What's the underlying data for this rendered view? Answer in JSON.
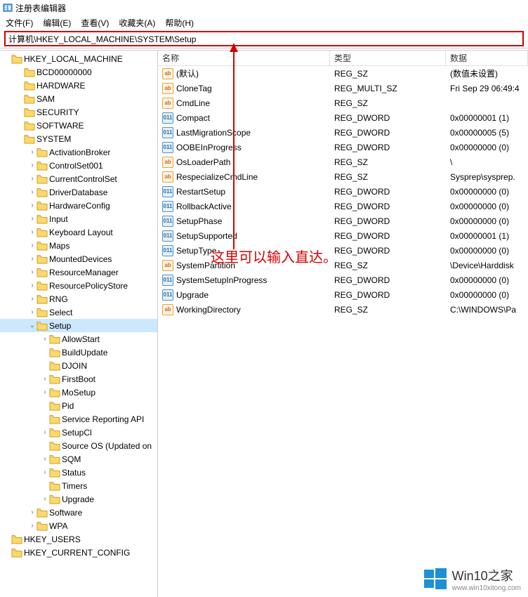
{
  "window": {
    "title": "注册表编辑器"
  },
  "menu": {
    "file": "文件(F)",
    "edit": "编辑(E)",
    "view": "查看(V)",
    "favorites": "收藏夹(A)",
    "help": "帮助(H)"
  },
  "address": {
    "path": "计算机\\HKEY_LOCAL_MACHINE\\SYSTEM\\Setup"
  },
  "tree": [
    {
      "depth": 0,
      "exp": "",
      "label": "HKEY_LOCAL_MACHINE"
    },
    {
      "depth": 1,
      "exp": "",
      "label": "BCD00000000"
    },
    {
      "depth": 1,
      "exp": "",
      "label": "HARDWARE"
    },
    {
      "depth": 1,
      "exp": "",
      "label": "SAM"
    },
    {
      "depth": 1,
      "exp": "",
      "label": "SECURITY"
    },
    {
      "depth": 1,
      "exp": "",
      "label": "SOFTWARE"
    },
    {
      "depth": 1,
      "exp": "",
      "label": "SYSTEM"
    },
    {
      "depth": 2,
      "exp": ">",
      "label": "ActivationBroker"
    },
    {
      "depth": 2,
      "exp": ">",
      "label": "ControlSet001"
    },
    {
      "depth": 2,
      "exp": ">",
      "label": "CurrentControlSet"
    },
    {
      "depth": 2,
      "exp": ">",
      "label": "DriverDatabase"
    },
    {
      "depth": 2,
      "exp": ">",
      "label": "HardwareConfig"
    },
    {
      "depth": 2,
      "exp": ">",
      "label": "Input"
    },
    {
      "depth": 2,
      "exp": ">",
      "label": "Keyboard Layout"
    },
    {
      "depth": 2,
      "exp": ">",
      "label": "Maps"
    },
    {
      "depth": 2,
      "exp": ">",
      "label": "MountedDevices"
    },
    {
      "depth": 2,
      "exp": ">",
      "label": "ResourceManager"
    },
    {
      "depth": 2,
      "exp": ">",
      "label": "ResourcePolicyStore"
    },
    {
      "depth": 2,
      "exp": ">",
      "label": "RNG"
    },
    {
      "depth": 2,
      "exp": ">",
      "label": "Select"
    },
    {
      "depth": 2,
      "exp": "v",
      "label": "Setup",
      "selected": true
    },
    {
      "depth": 3,
      "exp": ">",
      "label": "AllowStart"
    },
    {
      "depth": 3,
      "exp": "",
      "label": "BuildUpdate"
    },
    {
      "depth": 3,
      "exp": "",
      "label": "DJOIN"
    },
    {
      "depth": 3,
      "exp": ">",
      "label": "FirstBoot"
    },
    {
      "depth": 3,
      "exp": ">",
      "label": "MoSetup"
    },
    {
      "depth": 3,
      "exp": "",
      "label": "Pid"
    },
    {
      "depth": 3,
      "exp": "",
      "label": "Service Reporting API"
    },
    {
      "depth": 3,
      "exp": ">",
      "label": "SetupCl"
    },
    {
      "depth": 3,
      "exp": "",
      "label": "Source OS (Updated on"
    },
    {
      "depth": 3,
      "exp": ">",
      "label": "SQM"
    },
    {
      "depth": 3,
      "exp": ">",
      "label": "Status"
    },
    {
      "depth": 3,
      "exp": "",
      "label": "Timers"
    },
    {
      "depth": 3,
      "exp": ">",
      "label": "Upgrade"
    },
    {
      "depth": 2,
      "exp": ">",
      "label": "Software"
    },
    {
      "depth": 2,
      "exp": ">",
      "label": "WPA"
    },
    {
      "depth": 0,
      "exp": "",
      "label": "HKEY_USERS"
    },
    {
      "depth": 0,
      "exp": "",
      "label": "HKEY_CURRENT_CONFIG"
    }
  ],
  "columns": {
    "name": "名称",
    "type": "类型",
    "data": "数据"
  },
  "values": [
    {
      "icon": "sz",
      "name": "(默认)",
      "type": "REG_SZ",
      "data": "(数值未设置)"
    },
    {
      "icon": "sz",
      "name": "CloneTag",
      "type": "REG_MULTI_SZ",
      "data": "Fri Sep 29 06:49:4"
    },
    {
      "icon": "sz",
      "name": "CmdLine",
      "type": "REG_SZ",
      "data": ""
    },
    {
      "icon": "bin",
      "name": "Compact",
      "type": "REG_DWORD",
      "data": "0x00000001 (1)"
    },
    {
      "icon": "bin",
      "name": "LastMigrationScope",
      "type": "REG_DWORD",
      "data": "0x00000005 (5)"
    },
    {
      "icon": "bin",
      "name": "OOBEInProgress",
      "type": "REG_DWORD",
      "data": "0x00000000 (0)"
    },
    {
      "icon": "sz",
      "name": "OsLoaderPath",
      "type": "REG_SZ",
      "data": "\\"
    },
    {
      "icon": "sz",
      "name": "RespecializeCmdLine",
      "type": "REG_SZ",
      "data": "Sysprep\\sysprep."
    },
    {
      "icon": "bin",
      "name": "RestartSetup",
      "type": "REG_DWORD",
      "data": "0x00000000 (0)"
    },
    {
      "icon": "bin",
      "name": "RollbackActive",
      "type": "REG_DWORD",
      "data": "0x00000000 (0)"
    },
    {
      "icon": "bin",
      "name": "SetupPhase",
      "type": "REG_DWORD",
      "data": "0x00000000 (0)"
    },
    {
      "icon": "bin",
      "name": "SetupSupported",
      "type": "REG_DWORD",
      "data": "0x00000001 (1)"
    },
    {
      "icon": "bin",
      "name": "SetupType",
      "type": "REG_DWORD",
      "data": "0x00000000 (0)"
    },
    {
      "icon": "sz",
      "name": "SystemPartition",
      "type": "REG_SZ",
      "data": "\\Device\\Harddisk"
    },
    {
      "icon": "bin",
      "name": "SystemSetupInProgress",
      "type": "REG_DWORD",
      "data": "0x00000000 (0)"
    },
    {
      "icon": "bin",
      "name": "Upgrade",
      "type": "REG_DWORD",
      "data": "0x00000000 (0)"
    },
    {
      "icon": "sz",
      "name": "WorkingDirectory",
      "type": "REG_SZ",
      "data": "C:\\WINDOWS\\Pa"
    }
  ],
  "annotation": {
    "text": "这里可以输入直达。"
  },
  "watermark": {
    "brand": "Win10之家",
    "url": "www.win10xitong.com"
  }
}
